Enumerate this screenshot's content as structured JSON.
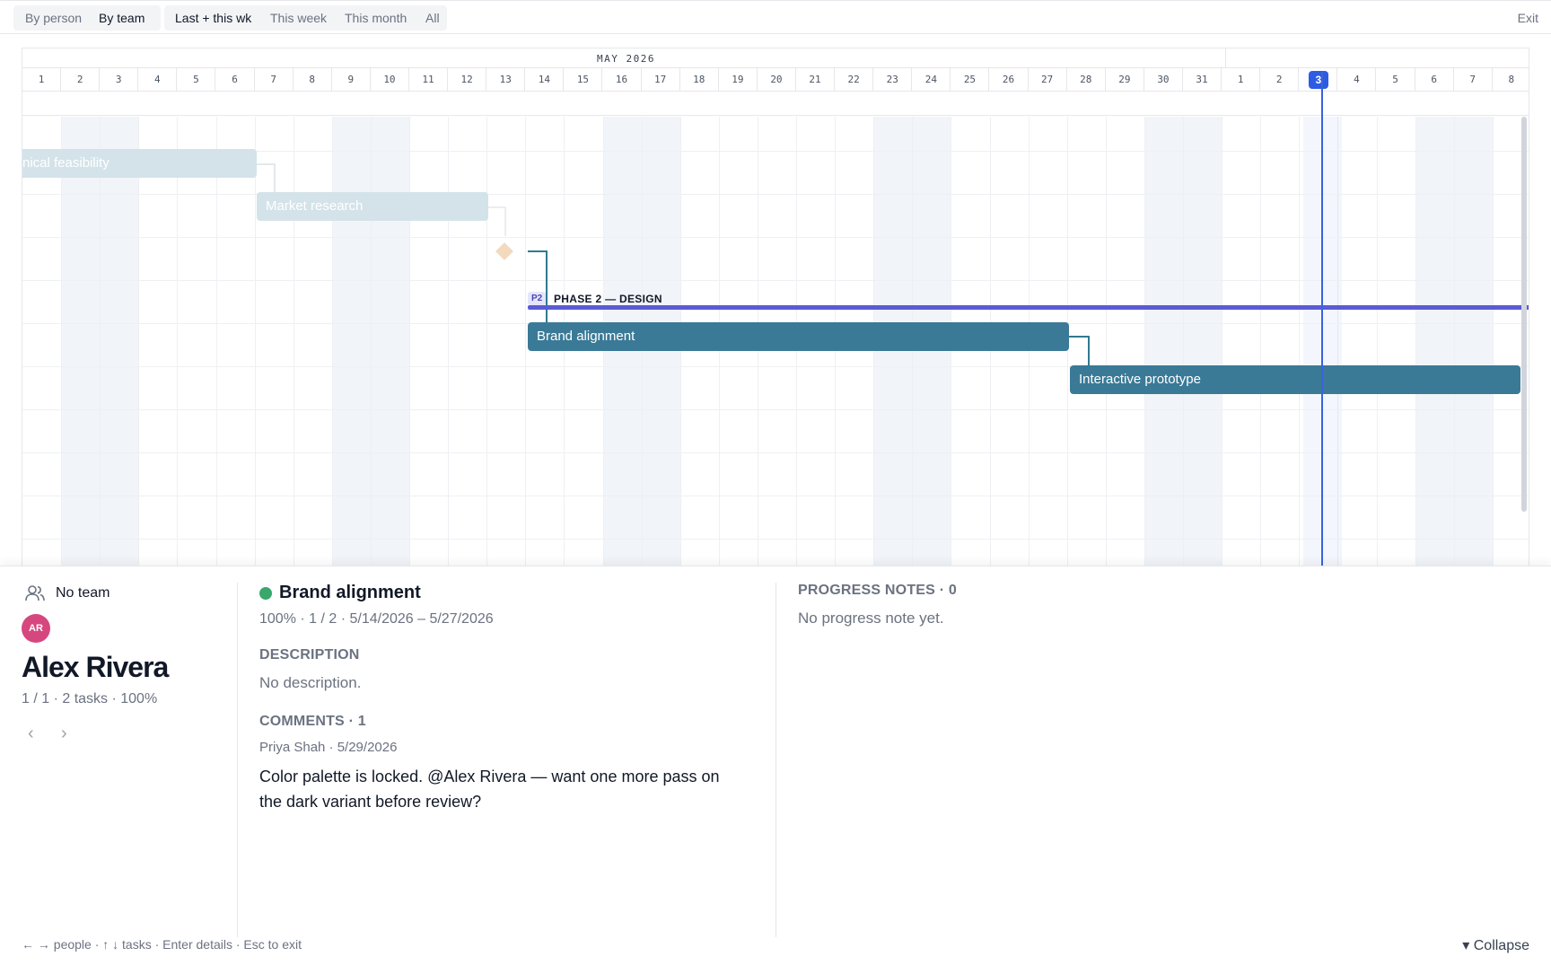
{
  "toolbar": {
    "by_person": "By person",
    "by_team": "By team",
    "last_this_wk": "Last + this wk",
    "this_week": "This week",
    "this_month": "This month",
    "all": "All",
    "exit": "Exit"
  },
  "timeline": {
    "month_label": "MAY 2026",
    "days": [
      "1",
      "2",
      "3",
      "4",
      "5",
      "6",
      "7",
      "8",
      "9",
      "10",
      "11",
      "12",
      "13",
      "14",
      "15",
      "16",
      "17",
      "18",
      "19",
      "20",
      "21",
      "22",
      "23",
      "24",
      "25",
      "26",
      "27",
      "28",
      "29",
      "30",
      "31",
      "1",
      "2",
      "3",
      "4",
      "5",
      "6",
      "7",
      "8"
    ],
    "today_label": "3",
    "tasks": {
      "technical_feasibility": "nical feasibility",
      "market_research": "Market research",
      "brand_alignment": "Brand alignment",
      "interactive_prototype": "Interactive prototype"
    },
    "phase": {
      "badge": "P2",
      "label": "PHASE 2 — DESIGN",
      "color": "#5b5bd6"
    },
    "colors": {
      "task_bar": "#3a7a97",
      "faded_bar": "#d4e3e9",
      "today": "#2d5be3",
      "milestone": "#f3d9bd"
    }
  },
  "person": {
    "team_label": "No team",
    "team_icon": "users-icon",
    "initials": "AR",
    "name": "Alex Rivera",
    "meta": "1 / 1 · 2 tasks · 100%",
    "prev": "‹",
    "next": "›"
  },
  "task": {
    "title": "Brand alignment",
    "status_color": "#3aa76d",
    "meta": "100% · 1 / 2 · 5/14/2026 – 5/27/2026",
    "description_label": "DESCRIPTION",
    "description": "No description.",
    "comments_label": "COMMENTS · 1",
    "comment_author": "Priya Shah · 5/29/2026",
    "comment_body": "Color palette is locked. @Alex Rivera — want one more pass on the dark variant before review?"
  },
  "progress": {
    "label": "PROGRESS NOTES · 0",
    "empty": "No progress note yet."
  },
  "footer": {
    "hint": "← → people · ↑ ↓ tasks · Enter details · Esc to exit",
    "collapse": "▾ Collapse"
  }
}
